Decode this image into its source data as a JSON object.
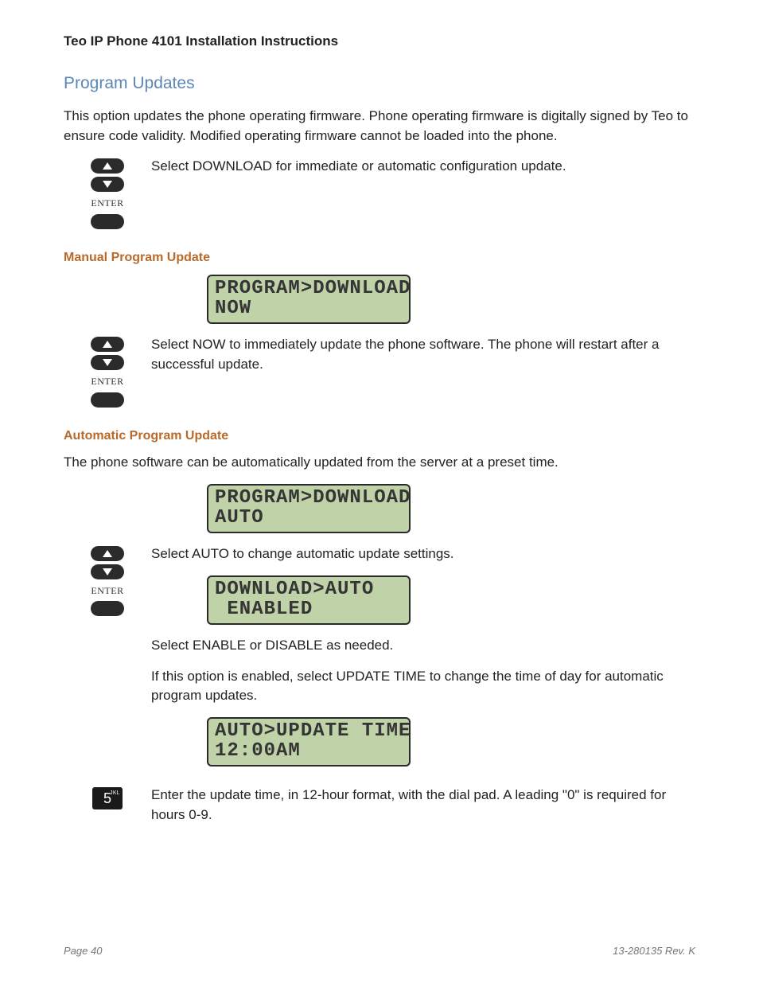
{
  "doc_title": "Teo IP Phone 4101 Installation Instructions",
  "section_title": "Program Updates",
  "intro": "This option updates the phone operating firmware. Phone operating firmware is digitally signed by Teo to ensure code validity. Modified operating firmware cannot be loaded into the phone.",
  "step1_text": "Select DOWNLOAD for immediate or automatic configuration update.",
  "enter_label": "ENTER",
  "manual": {
    "title": "Manual  Program Update",
    "lcd": "PROGRAM>DOWNLOAD\nNOW",
    "text": "Select NOW to immediately update the phone software. The phone will restart after a successful update."
  },
  "auto": {
    "title": "Automatic Program Update",
    "intro": "The phone software can be automatically updated from the server at a preset time.",
    "lcd1": "PROGRAM>DOWNLOAD\nAUTO",
    "step1": "Select AUTO to change automatic update settings.",
    "lcd2": "DOWNLOAD>AUTO\n ENABLED",
    "step2": "Select ENABLE or DISABLE as needed.",
    "step3": "If this option is enabled, select UPDATE TIME to change the time of day for automatic program updates.",
    "lcd3": "AUTO>UPDATE TIME\n12:00AM",
    "step4": "Enter the update time, in 12-hour format, with the dial pad. A leading \"0\" is required for hours 0-9."
  },
  "key5": {
    "digit": "5",
    "letters": "JKL"
  },
  "footer": {
    "page": "Page 40",
    "rev": "13-280135  Rev. K"
  }
}
